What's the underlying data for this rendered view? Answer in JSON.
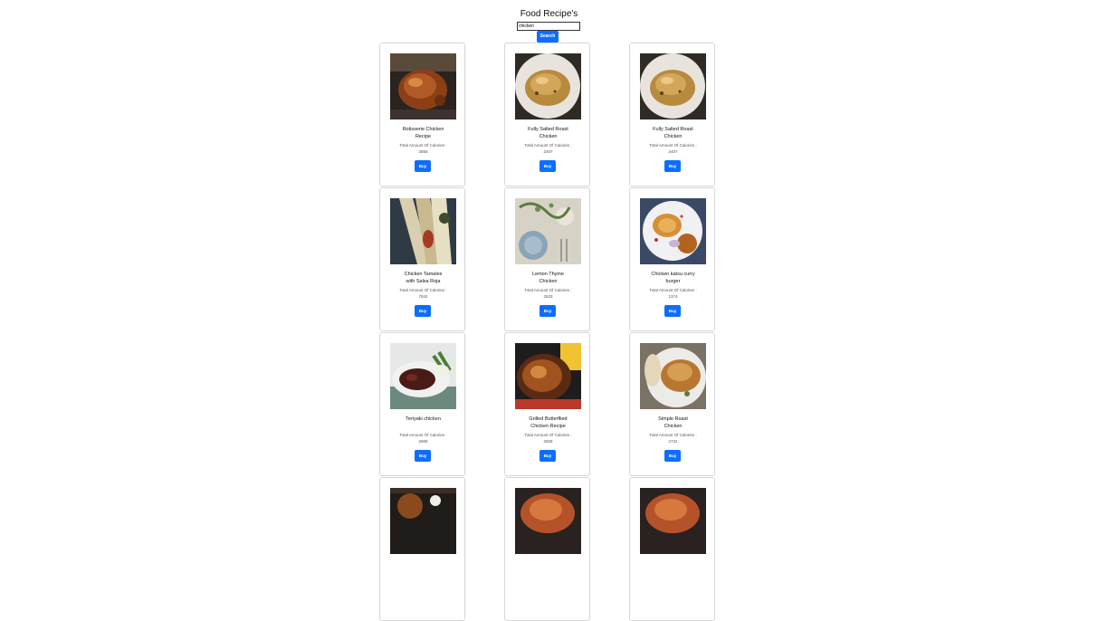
{
  "header": {
    "title": "Food Recipe's"
  },
  "search": {
    "value": "chicken",
    "button_label": "Search"
  },
  "recipes": [
    {
      "title_line1": "Rotisserie Chicken",
      "title_line2": "Recipe",
      "calories_label": "Total Amount Of Calories :",
      "calories": "2858",
      "buy_label": "Buy",
      "image": "roast-chicken-dark"
    },
    {
      "title_line1": "Fully Salted Roast",
      "title_line2": "Chicken",
      "calories_label": "Total Amount Of Calories :",
      "calories": "2407",
      "buy_label": "Buy",
      "image": "roast-chicken-plate"
    },
    {
      "title_line1": "Fully Salted Roast",
      "title_line2": "Chicken",
      "calories_label": "Total Amount Of Calories :",
      "calories": "2407",
      "buy_label": "Buy",
      "image": "roast-chicken-plate"
    },
    {
      "title_line1": "Chicken Tamales",
      "title_line2": "with Salsa Roja",
      "calories_label": "Total Amount Of Calories :",
      "calories": "7842",
      "buy_label": "Buy",
      "image": "tamales"
    },
    {
      "title_line1": "Lemon Thyme",
      "title_line2": "Chicken",
      "calories_label": "Total Amount Of Calories :",
      "calories": "2533",
      "buy_label": "Buy",
      "image": "lemon-thyme"
    },
    {
      "title_line1": "Chicken katsu curry",
      "title_line2": "burger",
      "calories_label": "Total Amount Of Calories :",
      "calories": "1374",
      "buy_label": "Buy",
      "image": "katsu-burger"
    },
    {
      "title_line1": "Teriyaki chicken",
      "title_line2": "",
      "calories_label": "Total Amount Of Calories :",
      "calories": "2805",
      "buy_label": "Buy",
      "image": "teriyaki"
    },
    {
      "title_line1": "Grilled Butterflied",
      "title_line2": "Chicken Recipe",
      "calories_label": "Total Amount Of Calories :",
      "calories": "2508",
      "buy_label": "Buy",
      "image": "grilled-butterflied"
    },
    {
      "title_line1": "Simple Roast",
      "title_line2": "Chicken",
      "calories_label": "Total Amount Of Calories :",
      "calories": "2732",
      "buy_label": "Buy",
      "image": "simple-roast"
    },
    {
      "title_line1": "",
      "title_line2": "",
      "calories_label": "",
      "calories": "",
      "buy_label": "",
      "image": "stew-dark"
    },
    {
      "title_line1": "",
      "title_line2": "",
      "calories_label": "",
      "calories": "",
      "buy_label": "",
      "image": "roast-chicken-red"
    },
    {
      "title_line1": "",
      "title_line2": "",
      "calories_label": "",
      "calories": "",
      "buy_label": "",
      "image": "roast-chicken-red"
    }
  ]
}
